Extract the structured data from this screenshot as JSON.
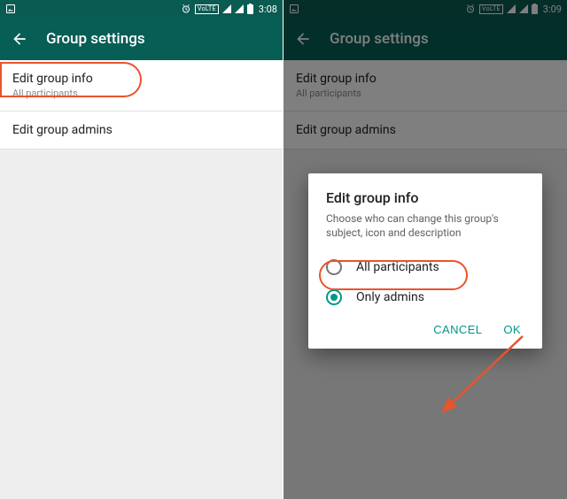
{
  "left": {
    "status": {
      "time": "3:08"
    },
    "appbar": {
      "title": "Group settings"
    },
    "items": [
      {
        "primary": "Edit group info",
        "secondary": "All participants"
      },
      {
        "primary": "Edit group admins"
      }
    ]
  },
  "right": {
    "status": {
      "time": "3:09"
    },
    "appbar": {
      "title": "Group settings"
    },
    "items": [
      {
        "primary": "Edit group info",
        "secondary": "All participants"
      },
      {
        "primary": "Edit group admins"
      }
    ],
    "dialog": {
      "title": "Edit group info",
      "description": "Choose who can change this group's subject, icon and description",
      "options": [
        {
          "label": "All participants",
          "checked": false
        },
        {
          "label": "Only admins",
          "checked": true
        }
      ],
      "cancel": "CANCEL",
      "ok": "OK"
    }
  }
}
